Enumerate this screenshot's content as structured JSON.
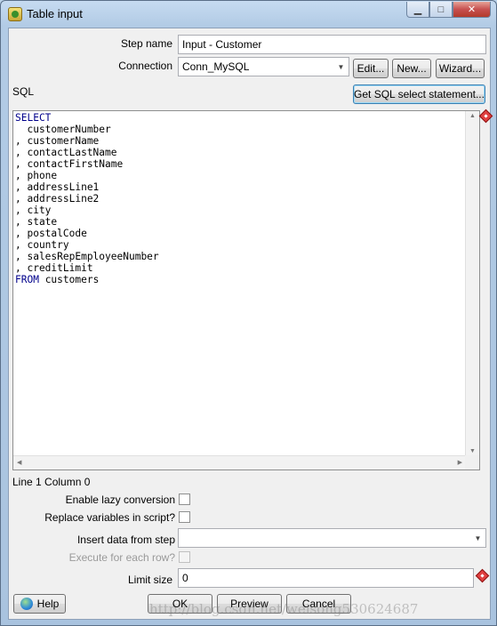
{
  "window": {
    "title": "Table input",
    "icon": "table-input-icon"
  },
  "form": {
    "step_name_label": "Step name",
    "step_name_value": "Input - Customer",
    "connection_label": "Connection",
    "connection_value": "Conn_MySQL",
    "edit_button": "Edit...",
    "new_button": "New...",
    "wizard_button": "Wizard...",
    "sql_label": "SQL",
    "get_sql_button": "Get SQL select statement...",
    "sql_lines": [
      {
        "kw": "SELECT",
        "text": ""
      },
      {
        "kw": "",
        "text": "  customerNumber"
      },
      {
        "kw": "",
        "text": ", customerName"
      },
      {
        "kw": "",
        "text": ", contactLastName"
      },
      {
        "kw": "",
        "text": ", contactFirstName"
      },
      {
        "kw": "",
        "text": ", phone"
      },
      {
        "kw": "",
        "text": ", addressLine1"
      },
      {
        "kw": "",
        "text": ", addressLine2"
      },
      {
        "kw": "",
        "text": ", city"
      },
      {
        "kw": "",
        "text": ", state"
      },
      {
        "kw": "",
        "text": ", postalCode"
      },
      {
        "kw": "",
        "text": ", country"
      },
      {
        "kw": "",
        "text": ", salesRepEmployeeNumber"
      },
      {
        "kw": "",
        "text": ", creditLimit"
      },
      {
        "kw": "FROM",
        "text": " customers"
      }
    ],
    "cursor_position": "Line 1 Column 0",
    "lazy_conversion_label": "Enable lazy conversion",
    "replace_variables_label": "Replace variables in script?",
    "insert_data_label": "Insert data from step",
    "insert_data_value": "",
    "execute_each_row_label": "Execute for each row?",
    "limit_size_label": "Limit size",
    "limit_size_value": "0"
  },
  "buttons": {
    "help": "Help",
    "ok": "OK",
    "preview": "Preview",
    "cancel": "Cancel"
  },
  "watermark": "http://blog.csdn.net/weisong530624687"
}
